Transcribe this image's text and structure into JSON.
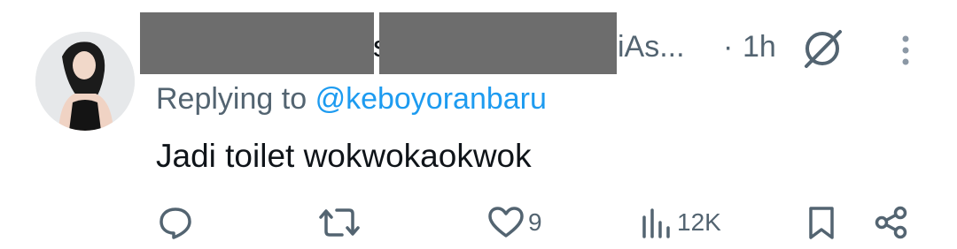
{
  "tweet": {
    "author_partial_left": "s",
    "author_partial_right": "iAs...",
    "separator": "·",
    "time": "1h",
    "replying_label": "Replying to",
    "replying_handle": "@keboyoranbaru",
    "text": "Jadi toilet wokwokaokwok"
  },
  "actions": {
    "likes": "9",
    "views": "12K"
  },
  "icons": {
    "verified": "no-entry-circle-icon",
    "more": "vertical-dots-icon",
    "reply": "comment-icon",
    "retweet": "retweet-icon",
    "like": "heart-icon",
    "views": "bar-chart-icon",
    "bookmark": "bookmark-icon",
    "share": "share-icon"
  },
  "colors": {
    "accent": "#1d9bf0",
    "muted": "#536471",
    "text": "#0f1419",
    "redaction": "#6d6d6d"
  }
}
